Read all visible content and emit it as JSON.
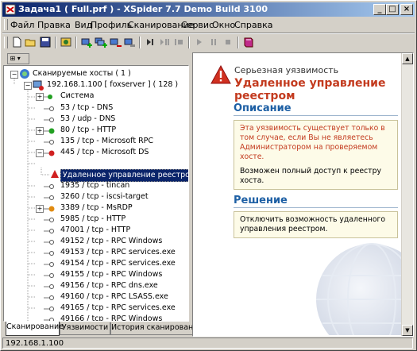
{
  "window": {
    "title": "Задача1 ( Full.prf ) - XSpider 7.7 Demo Build 3100",
    "controls": [
      "_",
      "□",
      "×"
    ]
  },
  "menu": [
    "Файл",
    "Правка",
    "Вид",
    "Профиль",
    "Сканирование",
    "Сервис",
    "Окно",
    "Справка"
  ],
  "toolbar": [
    "new-doc-icon",
    "open-folder-icon",
    "save-disk-icon",
    "profile-icon",
    "add-host-icon",
    "add-hosts-icon",
    "remove-host-icon",
    "host-settings-icon",
    "step-icon",
    "step-all-icon",
    "stop-step-icon",
    "start-icon",
    "pause-icon",
    "stop-icon",
    "book-icon"
  ],
  "tree": {
    "root": "Сканируемые хосты ( 1 )",
    "host": "192.168.1.100 [ foxserver ] ( 128 )",
    "system": "Система",
    "ports": [
      {
        "label": "53 / tcp - DNS",
        "expand": false,
        "bullet": "none"
      },
      {
        "label": "53 / udp - DNS",
        "expand": false,
        "bullet": "none"
      },
      {
        "label": "80 / tcp - HTTP",
        "expand": true,
        "bullet": "green"
      },
      {
        "label": "135 / tcp - Microsoft RPC",
        "expand": false,
        "bullet": "none"
      },
      {
        "label": "445 / tcp - Microsoft DS",
        "expand": true,
        "bullet": "red"
      }
    ],
    "selected_vuln": "Удаленное управление реестром",
    "more_ports": [
      {
        "label": "1935 / tcp - tincan",
        "expand": false,
        "bullet": "none"
      },
      {
        "label": "3260 / tcp - iscsi-target",
        "expand": false,
        "bullet": "none"
      },
      {
        "label": "3389 / tcp - MsRDP",
        "expand": true,
        "bullet": "orange"
      },
      {
        "label": "5985 / tcp - HTTP",
        "expand": false,
        "bullet": "none"
      },
      {
        "label": "47001 / tcp - HTTP",
        "expand": false,
        "bullet": "none"
      },
      {
        "label": "49152 / tcp - RPC  Windows",
        "expand": false,
        "bullet": "none"
      },
      {
        "label": "49153 / tcp - RPC  services.exe",
        "expand": false,
        "bullet": "none"
      },
      {
        "label": "49154 / tcp - RPC  services.exe",
        "expand": false,
        "bullet": "none"
      },
      {
        "label": "49155 / tcp - RPC  Windows",
        "expand": false,
        "bullet": "none"
      },
      {
        "label": "49156 / tcp - RPC  dns.exe",
        "expand": false,
        "bullet": "none"
      },
      {
        "label": "49160 / tcp - RPC  LSASS.exe",
        "expand": false,
        "bullet": "none"
      },
      {
        "label": "49165 / tcp - RPC  services.exe",
        "expand": false,
        "bullet": "none"
      },
      {
        "label": "49166 / tcp - RPC  Windows",
        "expand": false,
        "bullet": "none"
      }
    ]
  },
  "tabs": [
    "Сканирование",
    "Уязвимости",
    "История сканирований"
  ],
  "detail": {
    "severity": "Серьезная уязвимость",
    "name": "Удаленное управление реестром",
    "description_head": "Описание",
    "description_warning": "Эта уязвимость существует только в том случае, если Вы не являетесь Администратором на проверяемом хосте.",
    "description_text": "Возможен полный доступ к реестру хоста.",
    "solution_head": "Решение",
    "solution_text": "Отключить возможность удаленного управления реестром."
  },
  "status": "192.168.1.100",
  "colors": {
    "accent_blue": "#1d5fa4",
    "vuln_red": "#c33a1e",
    "title_blue": "#0a246a"
  }
}
